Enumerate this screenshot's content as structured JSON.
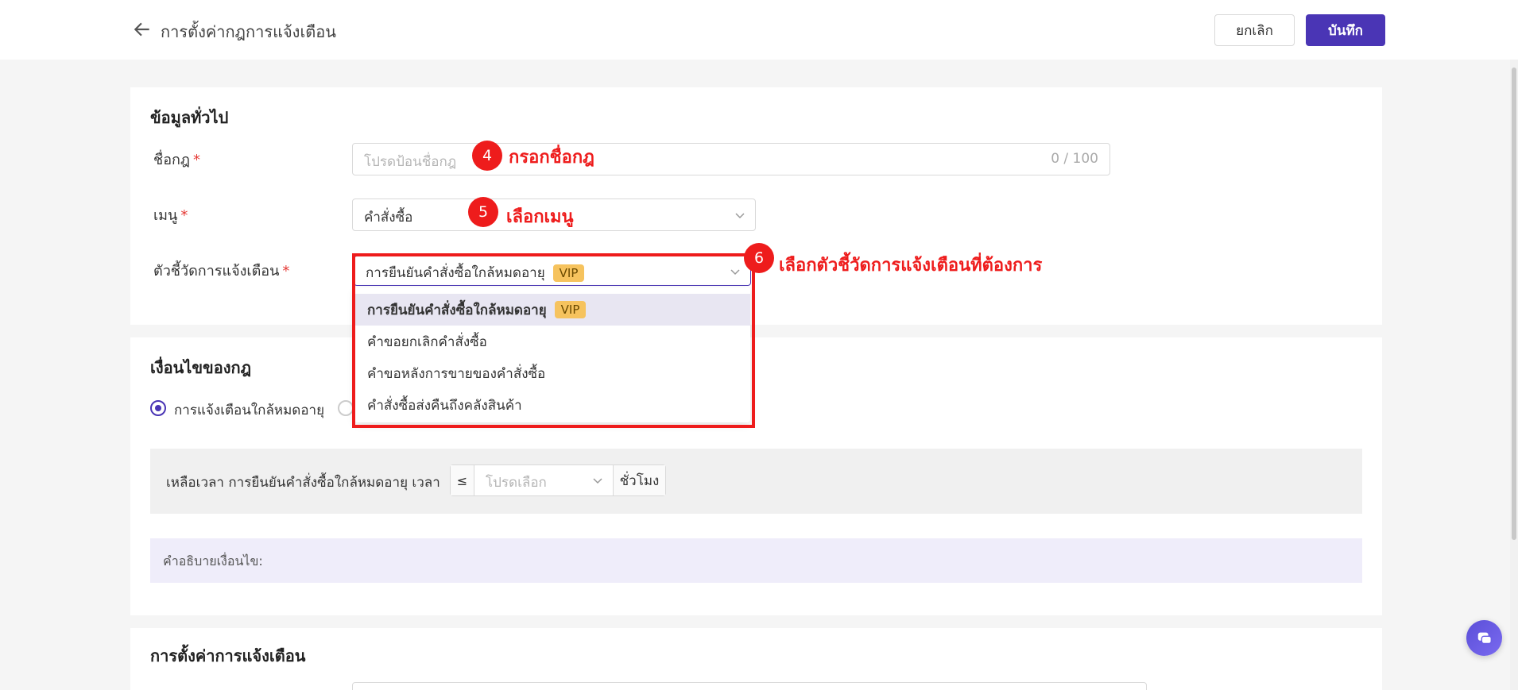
{
  "header": {
    "title": "การตั้งค่ากฎการแจ้งเตือน",
    "cancel_label": "ยกเลิก",
    "save_label": "บันทึก"
  },
  "general": {
    "section_title": "ข้อมูลทั่วไป",
    "rule_name_label": "ชื่อกฎ",
    "rule_name_placeholder": "โปรดป้อนชื่อกฎ",
    "rule_name_count": "0 / 100",
    "menu_label": "เมนู",
    "menu_value": "คำสั่งซื้อ",
    "indicator_label": "ตัวชี้วัดการแจ้งเตือน",
    "indicator_value": "การยืนยันคำสั่งซื้อใกล้หมดอายุ",
    "vip_label": "VIP",
    "required_mark": "*"
  },
  "dropdown": {
    "options": [
      {
        "label": "การยืนยันคำสั่งซื้อใกล้หมดอายุ",
        "vip": "VIP"
      },
      {
        "label": "คำขอยกเลิกคำสั่งซื้อ"
      },
      {
        "label": "คำขอหลังการขายของคำสั่งซื้อ"
      },
      {
        "label": "คำสั่งซื้อส่งคืนถึงคลังสินค้า"
      }
    ]
  },
  "annotations": {
    "step4": {
      "number": "4",
      "text": "กรอกชื่อกฎ"
    },
    "step5": {
      "number": "5",
      "text": "เลือกเมนู"
    },
    "step6": {
      "number": "6",
      "text": "เลือกตัวชี้วัดการแจ้งเตือนที่ต้องการ"
    },
    "color": "#ee1c1c"
  },
  "conditions": {
    "section_title": "เงื่อนไขของกฎ",
    "radio_selected_label": "การแจ้งเตือนใกล้หมดอายุ",
    "condition_prefix": "เหลือเวลา การยืนยันคำสั่งซื้อใกล้หมดอายุ เวลา",
    "operator": "≤",
    "time_placeholder": "โปรดเลือก",
    "unit": "ชั่วโมง",
    "description_label": "คำอธิบายเงื่อนไข:"
  },
  "notify": {
    "section_title": "การตั้งค่าการแจ้งเตือน"
  },
  "colors": {
    "primary": "#4a35b5",
    "vip": "#f6c35e"
  }
}
